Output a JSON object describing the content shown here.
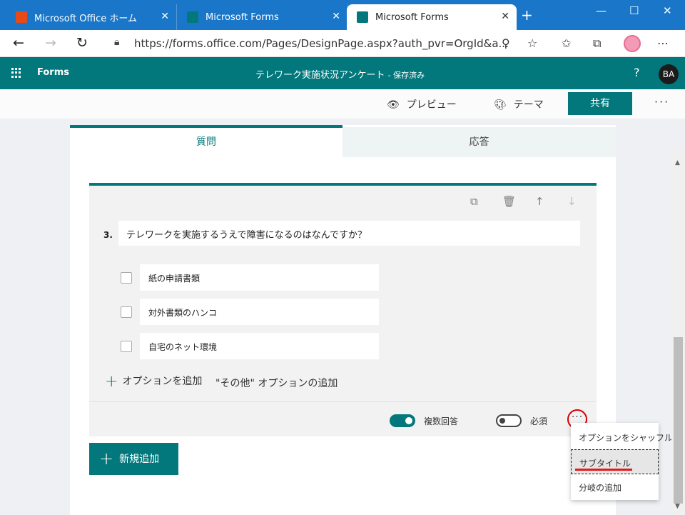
{
  "browser": {
    "tabs": [
      {
        "title": "Microsoft Office ホーム",
        "icon": "office-icon",
        "color": "#e64a19"
      },
      {
        "title": "Microsoft Forms",
        "icon": "forms-icon",
        "color": "#03787c"
      },
      {
        "title": "Microsoft Forms",
        "icon": "forms-icon",
        "color": "#03787c"
      }
    ],
    "new_tab": "+",
    "url": "https://forms.office.com/Pages/DesignPage.aspx?auth_pvr=OrgId&a...",
    "controls": {
      "minimize": "—",
      "maximize": "☐",
      "close": "✕"
    }
  },
  "app": {
    "name": "Forms",
    "title": "テレワーク実施状況アンケート",
    "title_suffix": "- 保存済み",
    "help": "?",
    "user_initials": "BA",
    "accent": "#03787c"
  },
  "commands": {
    "preview": "プレビュー",
    "theme": "テーマ",
    "share": "共有",
    "more": "···"
  },
  "tabs": {
    "questions": "質問",
    "responses": "応答"
  },
  "question": {
    "number": "3.",
    "text": "テレワークを実施するうえで障害になるのはなんですか？",
    "options": [
      "紙の申請書類",
      "対外書類のハンコ",
      "自宅のネット環境"
    ],
    "add_option": "オプションを追加",
    "add_other": "\"その他\" オプションの追加",
    "multiple_answers": {
      "label": "複数回答",
      "on": true
    },
    "required": {
      "label": "必須",
      "on": false
    },
    "more": "···"
  },
  "new_question_button": "新規追加",
  "context_menu": {
    "items": [
      "オプションをシャッフル",
      "サブタイトル",
      "分岐の追加"
    ],
    "selected": "サブタイトル"
  }
}
